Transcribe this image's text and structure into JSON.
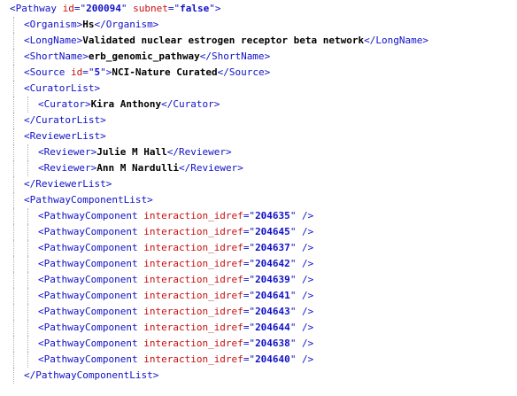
{
  "pathway": {
    "tag": "Pathway",
    "id_attr": "id",
    "id": "200094",
    "subnet_attr": "subnet",
    "subnet": "false"
  },
  "organism": {
    "tag": "Organism",
    "value": "Hs"
  },
  "long_name": {
    "tag": "LongName",
    "value": "Validated nuclear estrogen receptor beta network"
  },
  "short_name": {
    "tag": "ShortName",
    "value": "erb_genomic_pathway"
  },
  "source": {
    "tag": "Source",
    "id_attr": "id",
    "id": "5",
    "value": "NCI-Nature Curated"
  },
  "curator_list": {
    "tag": "CuratorList",
    "item_tag": "Curator",
    "items": [
      "Kira Anthony"
    ]
  },
  "reviewer_list": {
    "tag": "ReviewerList",
    "item_tag": "Reviewer",
    "items": [
      "Julie M Hall",
      "Ann M Nardulli"
    ]
  },
  "component_list": {
    "tag": "PathwayComponentList",
    "item_tag": "PathwayComponent",
    "attr": "interaction_idref",
    "items": [
      "204635",
      "204645",
      "204637",
      "204642",
      "204639",
      "204641",
      "204643",
      "204644",
      "204638",
      "204640"
    ]
  }
}
